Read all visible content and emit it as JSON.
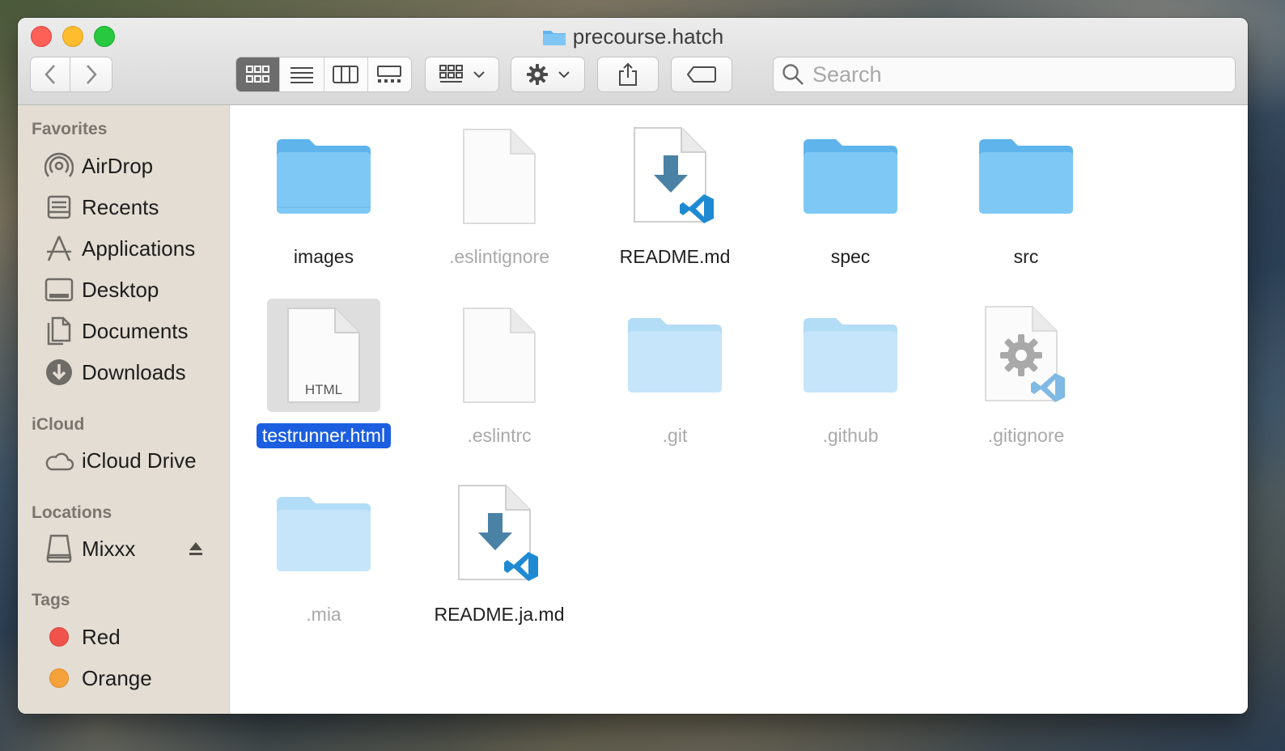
{
  "window": {
    "title": "precourse.hatch"
  },
  "toolbar": {
    "search_placeholder": "Search"
  },
  "sidebar": {
    "favorites_heading": "Favorites",
    "favorites": [
      {
        "label": "AirDrop",
        "icon": "airdrop-icon"
      },
      {
        "label": "Recents",
        "icon": "recents-icon"
      },
      {
        "label": "Applications",
        "icon": "applications-icon"
      },
      {
        "label": "Desktop",
        "icon": "desktop-icon"
      },
      {
        "label": "Documents",
        "icon": "documents-icon"
      },
      {
        "label": "Downloads",
        "icon": "downloads-icon"
      }
    ],
    "icloud_heading": "iCloud",
    "icloud": [
      {
        "label": "iCloud Drive",
        "icon": "cloud-icon"
      }
    ],
    "locations_heading": "Locations",
    "locations": [
      {
        "label": "Mixxx",
        "icon": "drive-icon"
      }
    ],
    "tags_heading": "Tags",
    "tags": [
      {
        "label": "Red",
        "color": "#f0524c"
      },
      {
        "label": "Orange",
        "color": "#f6a23b"
      }
    ]
  },
  "files": [
    {
      "name": "images",
      "kind": "folder",
      "hidden": false
    },
    {
      "name": ".eslintignore",
      "kind": "blank",
      "hidden": true
    },
    {
      "name": "README.md",
      "kind": "vscode-md",
      "hidden": false
    },
    {
      "name": "spec",
      "kind": "folder",
      "hidden": false
    },
    {
      "name": "src",
      "kind": "folder",
      "hidden": false
    },
    {
      "name": "testrunner.html",
      "kind": "html",
      "hidden": false,
      "selected": true,
      "badge": "HTML"
    },
    {
      "name": ".eslintrc",
      "kind": "blank",
      "hidden": true
    },
    {
      "name": ".git",
      "kind": "folder",
      "hidden": true
    },
    {
      "name": ".github",
      "kind": "folder",
      "hidden": true
    },
    {
      "name": ".gitignore",
      "kind": "vscode-gear",
      "hidden": true
    },
    {
      "name": ".mia",
      "kind": "folder",
      "hidden": true
    },
    {
      "name": "README.ja.md",
      "kind": "vscode-md",
      "hidden": false
    }
  ],
  "colors": {
    "selection": "#1b5ee0",
    "folder": "#6fc2f2"
  }
}
